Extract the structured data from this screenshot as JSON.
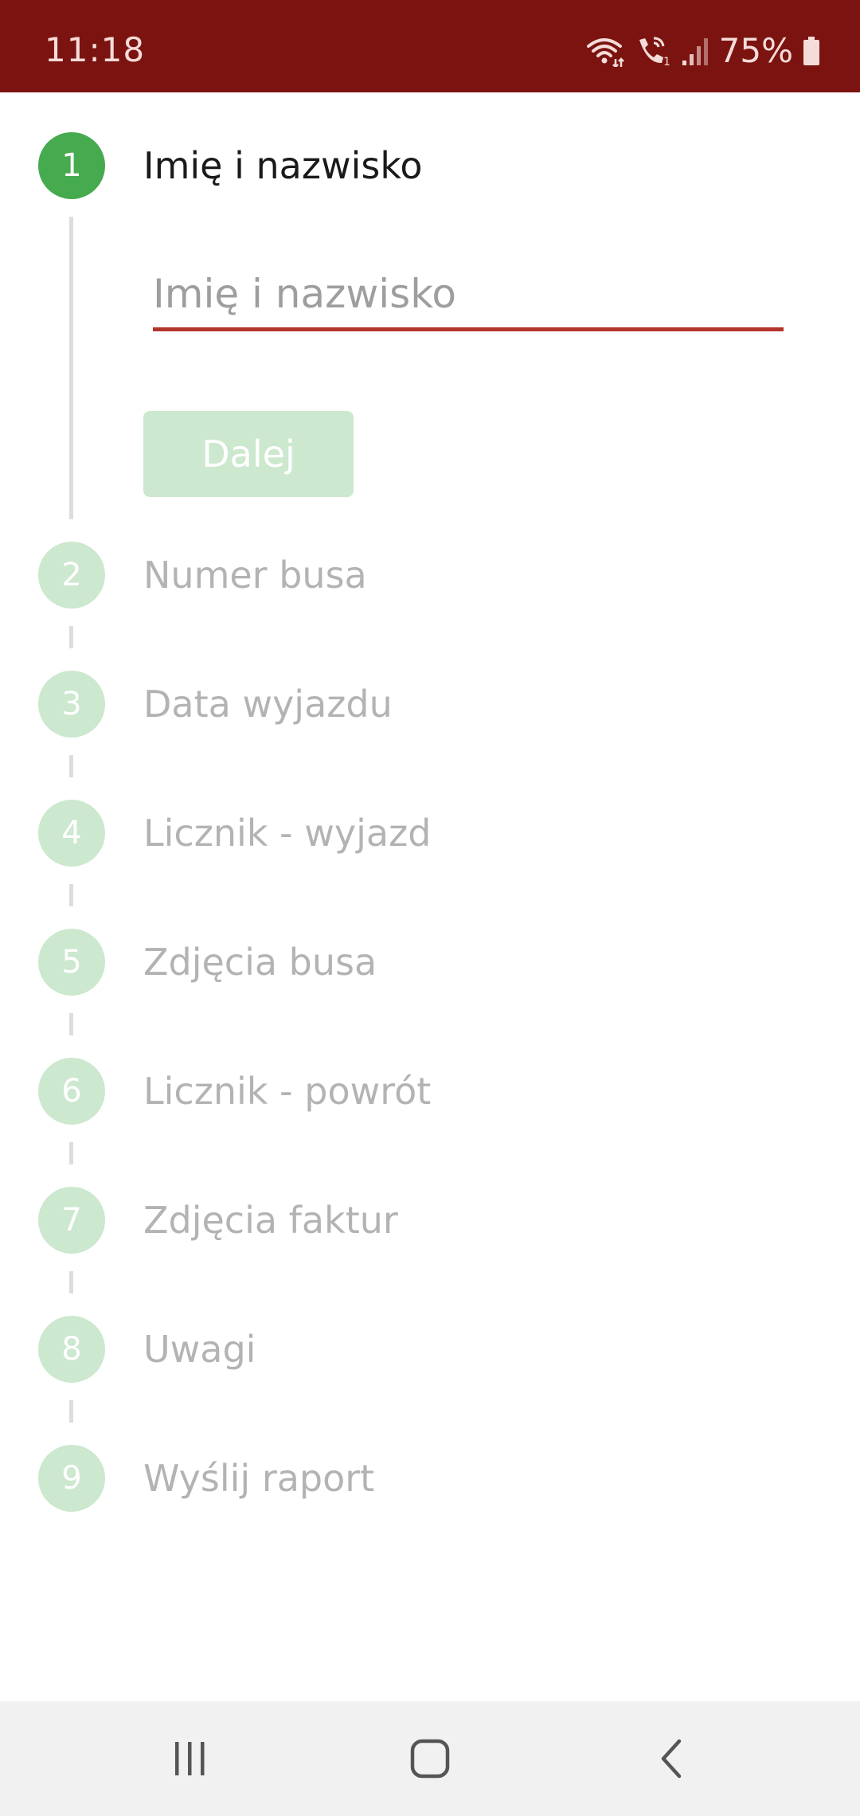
{
  "status_bar": {
    "time": "11:18",
    "battery": "75%",
    "icons": [
      "wifi-icon",
      "wifi-calling-icon",
      "signal-icon",
      "battery-icon"
    ],
    "color": "#7b1410"
  },
  "stepper": {
    "active_step": 1,
    "accent_color": "#46aa4e",
    "steps": [
      {
        "number": "1",
        "label": "Imię i nazwisko"
      },
      {
        "number": "2",
        "label": "Numer busa"
      },
      {
        "number": "3",
        "label": "Data wyjazdu"
      },
      {
        "number": "4",
        "label": "Licznik - wyjazd"
      },
      {
        "number": "5",
        "label": "Zdjęcia busa"
      },
      {
        "number": "6",
        "label": "Licznik - powrót"
      },
      {
        "number": "7",
        "label": "Zdjęcia faktur"
      },
      {
        "number": "8",
        "label": "Uwagi"
      },
      {
        "number": "9",
        "label": "Wyślij raport"
      }
    ]
  },
  "form": {
    "name_field": {
      "placeholder": "Imię i nazwisko",
      "value": ""
    },
    "next_button": "Dalej"
  },
  "nav_bar": {
    "buttons": [
      "recent-apps-icon",
      "home-icon",
      "back-icon"
    ]
  }
}
